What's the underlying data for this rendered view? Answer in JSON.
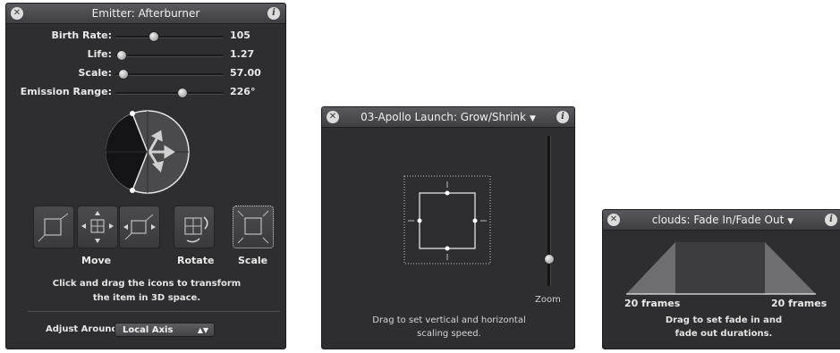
{
  "emitter_panel": {
    "title": "Emitter: Afterburner",
    "close_icon": "close-icon",
    "info_icon": "info-icon",
    "sliders": [
      {
        "label": "Birth Rate:",
        "value": "105",
        "position": 0.35
      },
      {
        "label": "Life:",
        "value": "1.27",
        "position": 0.05
      },
      {
        "label": "Scale:",
        "value": "57.00",
        "position": 0.07
      },
      {
        "label": "Emission Range:",
        "value": "226°",
        "position": 0.62
      }
    ],
    "tools": {
      "move_label": "Move",
      "rotate_label": "Rotate",
      "scale_label": "Scale"
    },
    "instructions_line1": "Click and drag the icons to transform",
    "instructions_line2": "the item in 3D space.",
    "adjust_label": "Adjust Around:",
    "adjust_value": "Local Axis"
  },
  "grow_panel": {
    "title": "03-Apollo Launch: Grow/Shrink",
    "zoom_label": "Zoom",
    "zoom_level": 0.2,
    "instructions_line1": "Drag to set vertical and horizontal",
    "instructions_line2": "scaling speed."
  },
  "fade_panel": {
    "title": "clouds: Fade In/Fade Out",
    "fade_in": "20 frames",
    "fade_out": "20 frames",
    "instructions_line1": "Drag to set fade in and",
    "instructions_line2": "fade out durations."
  }
}
